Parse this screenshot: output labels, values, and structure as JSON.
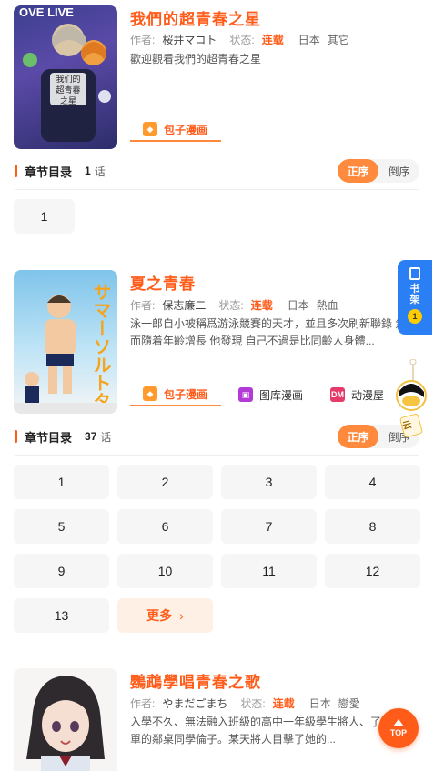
{
  "mangas": [
    {
      "title": "我們的超青春之星",
      "author_label": "作者:",
      "author": "桜井マコト",
      "status_label": "状态:",
      "status": "连载",
      "tags": [
        "日本",
        "其它"
      ],
      "description": "歡迎觀看我們的超青春之星",
      "cover_text": {
        "line1": "我们的",
        "line2": "超青春",
        "line3": "之星",
        "top": "OVE LIVE"
      },
      "sources": [
        {
          "label": "包子漫画",
          "icon": "bao-icon",
          "active": true
        }
      ],
      "chapters_label": "章节目录",
      "chapter_count": "1",
      "chapter_unit": "话",
      "order_asc": "正序",
      "order_desc": "倒序",
      "chapters": [
        "1"
      ]
    },
    {
      "title": "夏之青春",
      "author_label": "作者:",
      "author": "保志廉二",
      "status_label": "状态:",
      "status": "连载",
      "tags": [
        "日本",
        "熱血"
      ],
      "description": "泳一郎自小被稱爲游泳競賽的天才，並且多次刷新聯錄 然而隨着年齡增長 他發現 自己不過是比同齡人身體...",
      "cover_text": {
        "vertical": "サマーソルトターン"
      },
      "sources": [
        {
          "label": "包子漫画",
          "icon": "bao-icon",
          "active": true
        },
        {
          "label": "图库漫画",
          "icon": "image-icon",
          "active": false
        },
        {
          "label": "动漫屋",
          "icon": "dm-icon",
          "active": false
        }
      ],
      "chapters_label": "章节目录",
      "chapter_count": "37",
      "chapter_unit": "话",
      "order_asc": "正序",
      "order_desc": "倒序",
      "chapters": [
        "1",
        "2",
        "3",
        "4",
        "5",
        "6",
        "7",
        "8",
        "9",
        "10",
        "11",
        "12",
        "13"
      ],
      "more_label": "更多"
    },
    {
      "title": "鸚鵡學唱青春之歌",
      "author_label": "作者:",
      "author": "やまだごまち",
      "status_label": "状态:",
      "status": "连载",
      "tags": [
        "日本",
        "戀愛"
      ],
      "description": "入學不久、無法融入班級的高中一年級學生將人、了同樣落單的鄰桌同學倫子。某天將人目擊了她的..."
    }
  ],
  "sidebar": {
    "line1": "书",
    "line2": "架",
    "badge": "1"
  },
  "top_button": "TOP",
  "float_tag": "云",
  "colors": {
    "accent": "#ff5c1a",
    "accent_light": "#ff8a3d",
    "blue": "#2b7ff5"
  }
}
